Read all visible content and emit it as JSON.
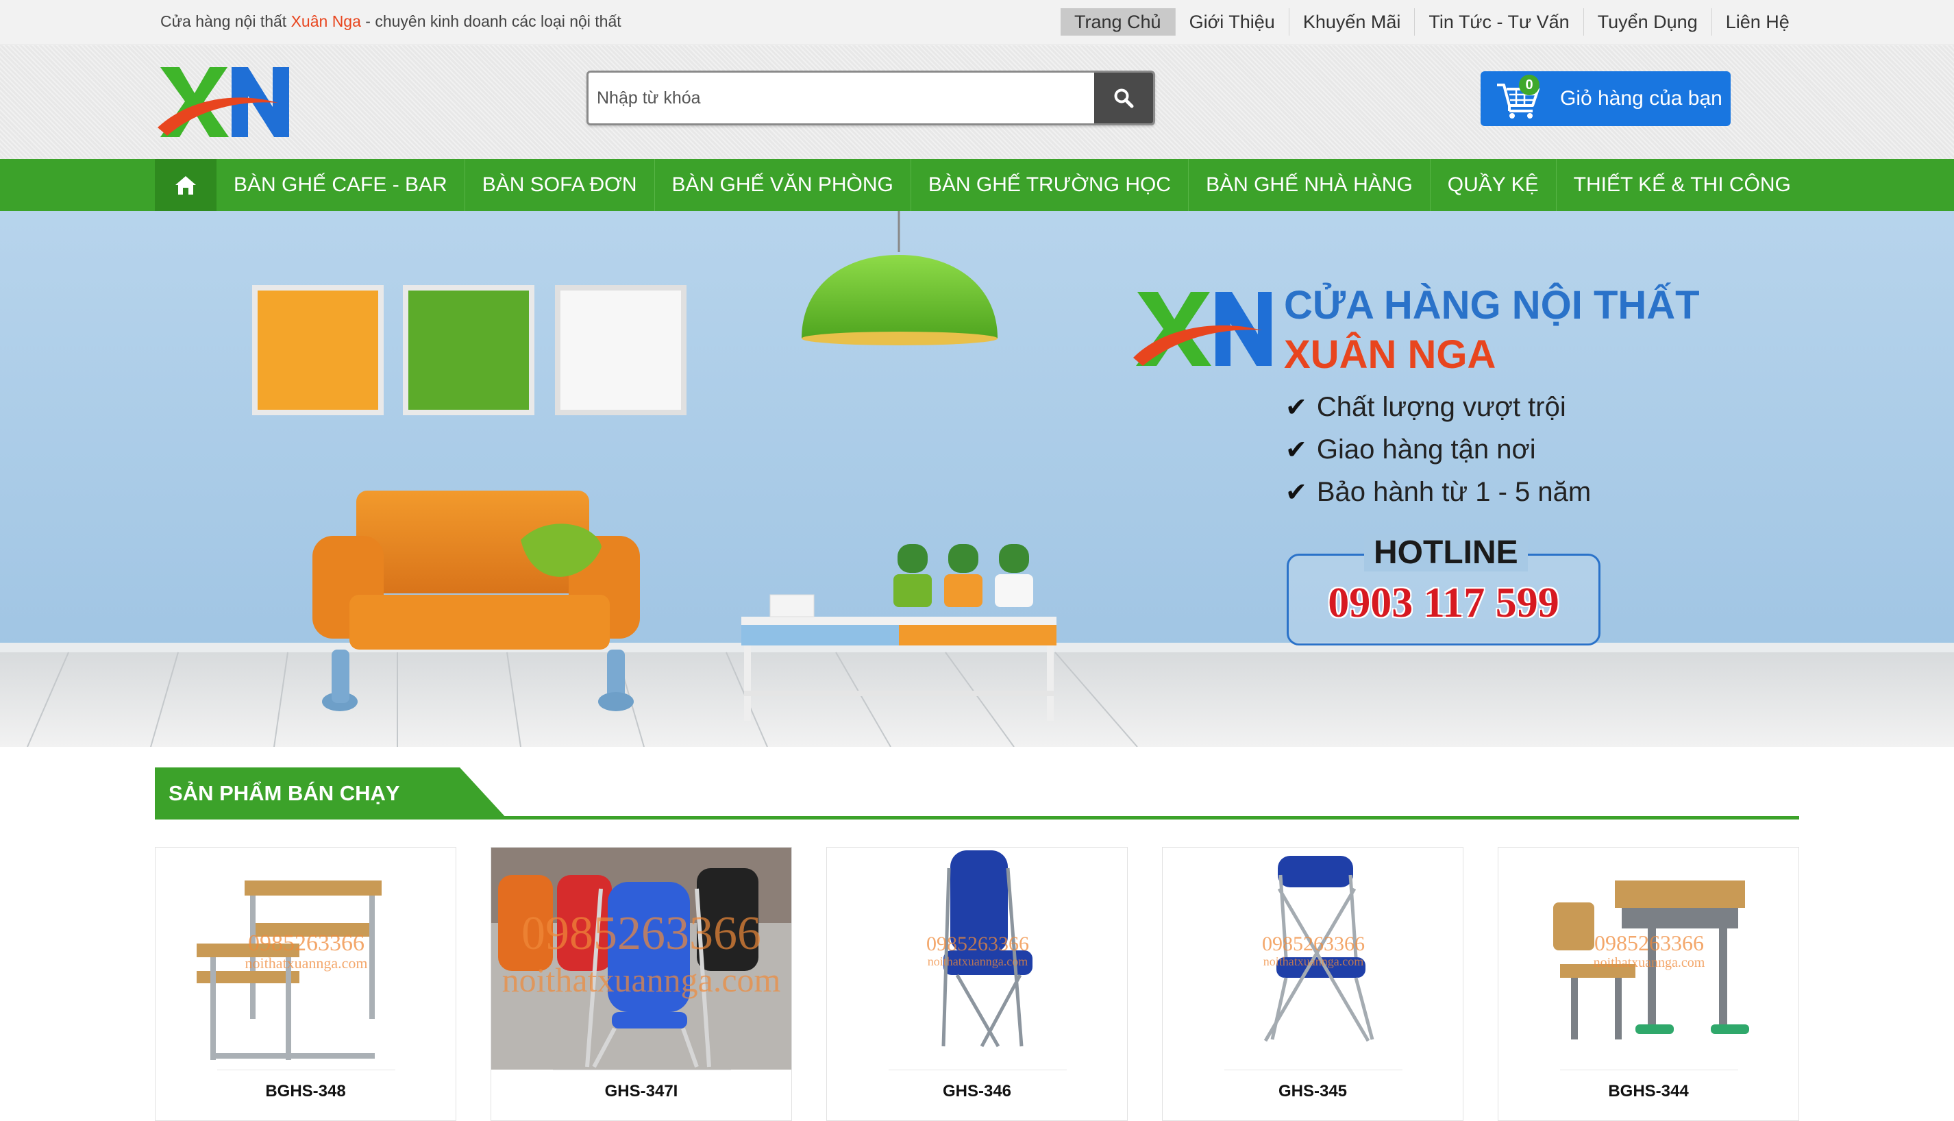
{
  "topbar": {
    "tagline_prefix": "Cửa hàng nội thất ",
    "tagline_brand": "Xuân Nga",
    "tagline_suffix": " - chuyên kinh doanh các loại nội thất",
    "links": [
      "Trang Chủ",
      "Giới Thiệu",
      "Khuyến Mãi",
      "Tin Tức - Tư Vấn",
      "Tuyển Dụng",
      "Liên Hệ"
    ],
    "active": "Trang Chủ"
  },
  "header": {
    "logo_text": "XN",
    "search_placeholder": "Nhập từ khóa",
    "cart_count": "0",
    "cart_label": "Giỏ hàng của bạn"
  },
  "mainnav": {
    "items": [
      "BÀN GHẾ CAFE - BAR",
      "BÀN SOFA ĐƠN",
      "BÀN GHẾ VĂN PHÒNG",
      "BÀN GHẾ TRƯỜNG HỌC",
      "BÀN GHẾ NHÀ HÀNG",
      "QUẦY KỆ",
      "THIẾT KẾ & THI CÔNG"
    ]
  },
  "banner": {
    "logo_text": "XN",
    "title_line1": "CỬA HÀNG NỘI THẤT",
    "title_line2": "XUÂN NGA",
    "features": [
      "Chất lượng vượt trội",
      "Giao hàng tận nơi",
      "Bảo hành từ 1 - 5 năm"
    ],
    "hotline_label": "HOTLINE",
    "hotline_number": "0903 117 599"
  },
  "section": {
    "title": "SẢN PHẨM BÁN CHẠY"
  },
  "products": [
    {
      "name": "BGHS-348",
      "watermark": "0985263366",
      "watermark_site": "noithatxuannga.com"
    },
    {
      "name": "GHS-347I",
      "watermark": "0985263366",
      "watermark_site": "noithatxuannga.com"
    },
    {
      "name": "GHS-346",
      "watermark": "0985263366",
      "watermark_site": "noithatxuannga.com"
    },
    {
      "name": "GHS-345",
      "watermark": "0985263366",
      "watermark_site": "noithatxuannga.com"
    },
    {
      "name": "BGHS-344",
      "watermark": "0985263366",
      "watermark_site": "noithatxuannga.com"
    }
  ],
  "colors": {
    "green": "#3ca22a",
    "orange_brand": "#e8451e",
    "cart_blue": "#1976e0",
    "banner_blue": "#a9cbe6"
  }
}
